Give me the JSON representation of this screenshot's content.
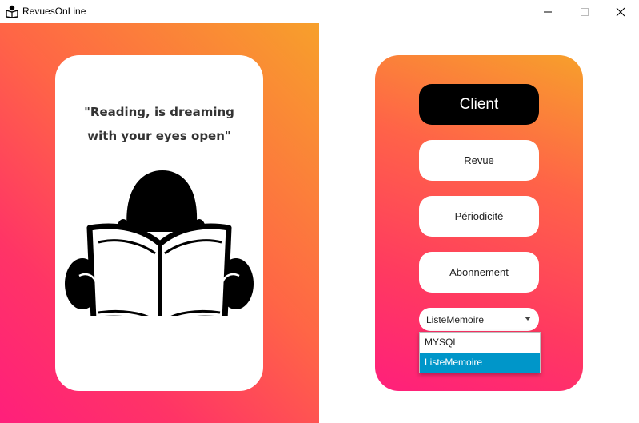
{
  "window": {
    "title": "RevuesOnLine",
    "controls": {
      "minimize": "minimize",
      "maximize": "maximize",
      "close": "close"
    }
  },
  "quote": {
    "line1": "\"Reading, is dreaming",
    "line2": "with your eyes open\""
  },
  "menu": {
    "client": "Client",
    "revue": "Revue",
    "periodicite": "Périodicité",
    "abonnement": "Abonnement"
  },
  "persistence": {
    "selected": "ListeMemoire",
    "options": [
      "MYSQL",
      "ListeMemoire"
    ]
  },
  "colors": {
    "gradient_top": "#f7a02b",
    "gradient_bottom": "#ff1f7b",
    "client_button": "#000000",
    "selection": "#0096c9"
  }
}
